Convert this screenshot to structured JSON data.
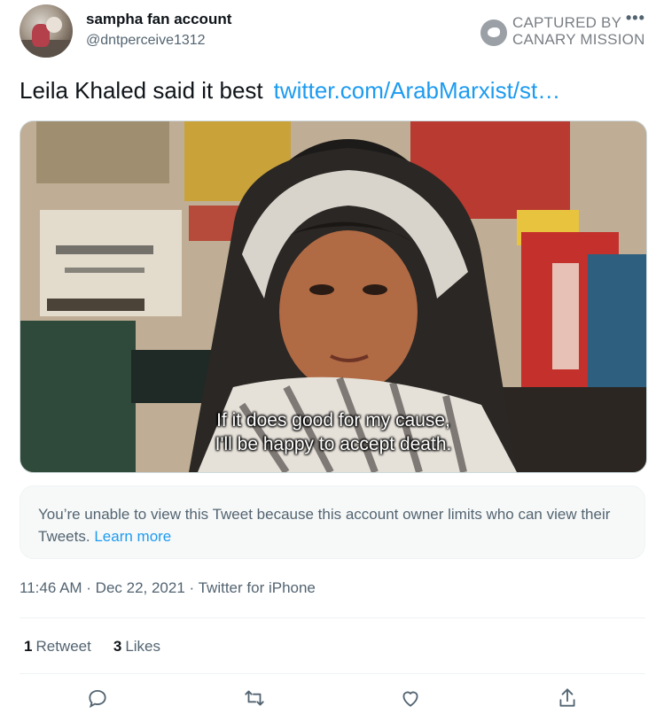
{
  "author": {
    "display_name": "sampha fan account",
    "handle": "@dntperceive1312"
  },
  "watermark": {
    "line1": "CAPTURED BY",
    "line2": "CANARY MISSION"
  },
  "more_label": "•••",
  "tweet": {
    "text": "Leila Khaled said it best",
    "link": "twitter.com/ArabMarxist/st…"
  },
  "media": {
    "subtitle_line1": "If it does good for my cause,",
    "subtitle_line2": "I'll be happy to accept death."
  },
  "notice": {
    "text": "You’re unable to view this Tweet because this account owner limits who can view their Tweets.",
    "link": "Learn more"
  },
  "meta": "11:46 AM · Dec 22, 2021 · Twitter for iPhone",
  "stats": {
    "retweets_count": "1",
    "retweets_label": "Retweet",
    "likes_count": "3",
    "likes_label": "Likes"
  },
  "icons": {
    "reply": "reply-icon",
    "retweet": "retweet-icon",
    "like": "like-icon",
    "share": "share-icon"
  },
  "colors": {
    "link": "#1d9bf0",
    "secondary_text": "#536471",
    "primary_text": "#0f1419"
  }
}
